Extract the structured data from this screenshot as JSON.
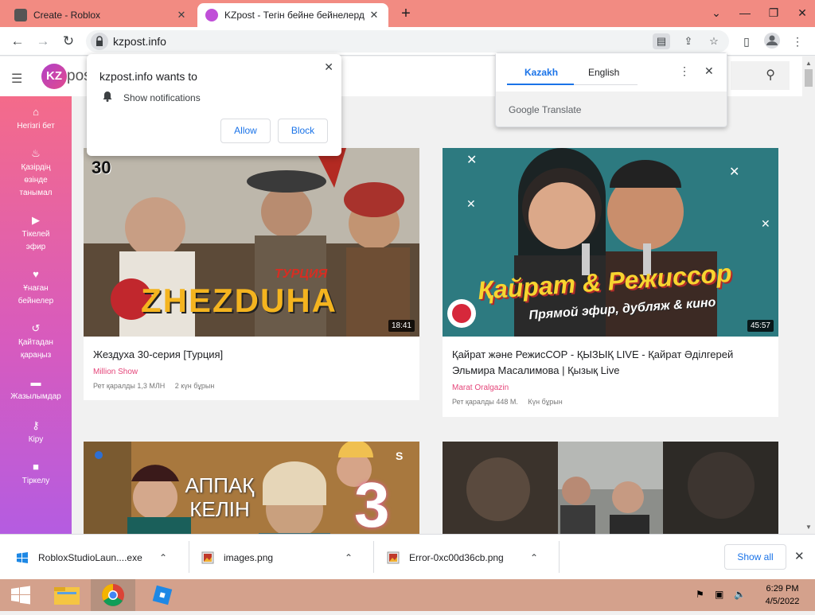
{
  "browser": {
    "tabs": [
      {
        "label": "Create - Roblox",
        "active": false
      },
      {
        "label": "KZpost - Тегін бейне бейнелерд",
        "active": true
      }
    ],
    "new_tab": "+",
    "url": "kzpost.info"
  },
  "site": {
    "logo_initials": "KZ",
    "logo_text": "post",
    "sidebar": [
      {
        "icon": "home-icon",
        "label": "Негізгі бет"
      },
      {
        "icon": "fire-icon",
        "label": "Қазірдің өзінде танымал"
      },
      {
        "icon": "live-icon",
        "label": "Тікелей эфир"
      },
      {
        "icon": "heart-icon",
        "label": "Ұнаған бейнелер"
      },
      {
        "icon": "history-icon",
        "label": "Қайтадан қараңыз"
      },
      {
        "icon": "folder-icon",
        "label": "Жазылымдар"
      },
      {
        "icon": "key-icon",
        "label": "Кіру"
      },
      {
        "icon": "lock-icon",
        "label": "Тіркелу"
      }
    ],
    "videos": [
      {
        "title": "Жездуха 30-серия [Турция]",
        "channel": "Million Show",
        "views": "Рет қаралды 1,3 МЛН",
        "age": "2 күн бұрын",
        "duration": "18:41",
        "thumb_text": "ZHEZDUHA",
        "thumb_badge": "30",
        "thumb_sub": "ТУРЦИЯ"
      },
      {
        "title": "Қайрат және РежисСОР - ҚЫЗЫҚ LIVE - Қайрат Әділгерей Эльмира Масалимова | Қызық Live",
        "channel": "Marat Oralgazin",
        "views": "Рет қаралды 448 М.",
        "age": "Күн бұрын",
        "duration": "45:57",
        "thumb_text": "Қайрат & Режиссор",
        "thumb_sub": "Прямой эфир, дубляж & кино"
      },
      {
        "thumb_text": "АППАҚ КЕЛІН",
        "thumb_num": "3"
      },
      {
        "thumb_text": ""
      }
    ]
  },
  "notification_popup": {
    "heading": "kzpost.info wants to",
    "message": "Show notifications",
    "allow": "Allow",
    "block": "Block"
  },
  "translate_popup": {
    "lang_selected": "Kazakh",
    "lang_other": "English",
    "brand": "Google Translate"
  },
  "downloads": [
    {
      "name": "RobloxStudioLaun....exe"
    },
    {
      "name": "images.png"
    },
    {
      "name": "Error-0xc00d36cb.png"
    }
  ],
  "download_show_all": "Show all",
  "clock": {
    "time": "6:29 PM",
    "date": "4/5/2022"
  }
}
